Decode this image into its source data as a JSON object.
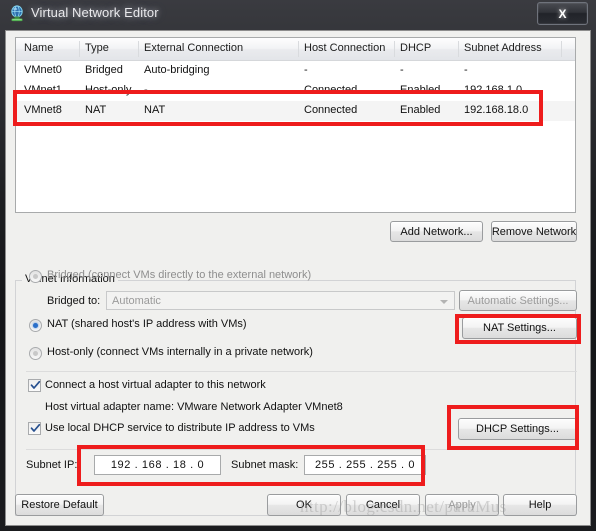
{
  "window": {
    "title": "Virtual Network Editor",
    "icon": "vmware-network-globe-icon",
    "close_label": "X"
  },
  "table": {
    "columns": [
      "Name",
      "Type",
      "External Connection",
      "Host Connection",
      "DHCP",
      "Subnet Address"
    ],
    "rows": [
      {
        "name": "VMnet0",
        "type": "Bridged",
        "external_connection": "Auto-bridging",
        "host_connection": "-",
        "dhcp": "-",
        "subnet_address": "-"
      },
      {
        "name": "VMnet1",
        "type": "Host-only",
        "external_connection": "-",
        "host_connection": "Connected",
        "dhcp": "Enabled",
        "subnet_address": "192.168.1.0"
      },
      {
        "name": "VMnet8",
        "type": "NAT",
        "external_connection": "NAT",
        "host_connection": "Connected",
        "dhcp": "Enabled",
        "subnet_address": "192.168.18.0"
      }
    ]
  },
  "toolbar": {
    "add_network": "Add Network...",
    "remove_network": "Remove Network"
  },
  "group": {
    "title": "VMnet Information",
    "bridged_label": "Bridged (connect VMs directly to the external network)",
    "bridged_to_label": "Bridged to:",
    "bridged_to_value": "Automatic",
    "automatic_settings": "Automatic Settings...",
    "nat_label": "NAT (shared host's IP address with VMs)",
    "nat_settings": "NAT Settings...",
    "host_only_label": "Host-only (connect VMs internally in a private network)",
    "connect_adapter_label": "Connect a host virtual adapter to this network",
    "adapter_name_label": "Host virtual adapter name: VMware Network Adapter VMnet8",
    "dhcp_service_label": "Use local DHCP service to distribute IP address to VMs",
    "dhcp_settings": "DHCP Settings...",
    "subnet_ip_label": "Subnet IP:",
    "subnet_ip_value": "192 . 168 . 18 .  0",
    "subnet_mask_label": "Subnet mask:",
    "subnet_mask_value": "255 . 255 . 255 .  0",
    "selected_mode": "nat",
    "connect_adapter_checked": true,
    "dhcp_service_checked": true
  },
  "footer": {
    "restore_default": "Restore Default",
    "ok": "OK",
    "cancel": "Cancel",
    "apply": "Apply",
    "help": "Help"
  },
  "watermark": {
    "text": "http://blog.csdn.net/paraMus"
  },
  "colors": {
    "highlight": "#ee1c1c",
    "accent": "#2a6fc9",
    "dialog_bg": "#f0f0ee"
  }
}
